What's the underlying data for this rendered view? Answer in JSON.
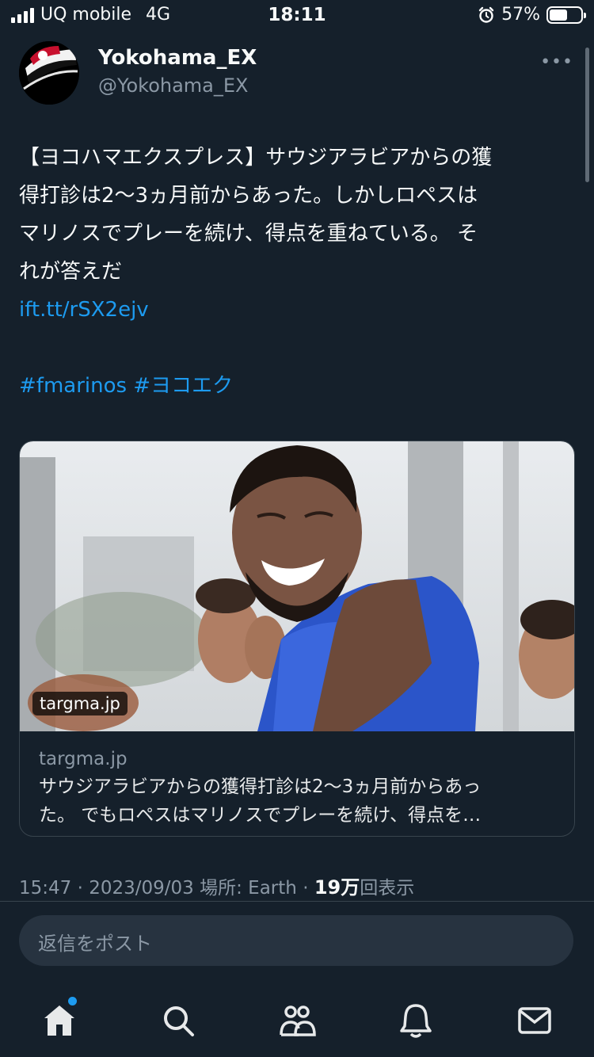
{
  "status_bar": {
    "carrier": "UQ mobile",
    "network": "4G",
    "time": "18:11",
    "battery_percent": "57%",
    "battery_level": 0.57,
    "icons": [
      "signal-icon",
      "alarm-icon",
      "battery-icon"
    ]
  },
  "tweet": {
    "display_name": "Yokohama_EX",
    "handle": "@Yokohama_EX",
    "more_label": "•••",
    "text_lines": [
      "【ヨコハマエクスプレス】サウジアラビアからの獲",
      "得打診は2〜3ヵ月前からあった。しかしロペスは",
      "マリノスでプレーを続け、得点を重ねている。 そ",
      "れが答えだ"
    ],
    "link": "ift.tt/rSX2ejv",
    "hashtags": "#fmarinos #ヨコエク",
    "card": {
      "domain_badge": "targma.jp",
      "domain": "targma.jp",
      "title_line1": "サウジアラビアからの獲得打診は2〜3ヵ月前からあっ",
      "title_line2": "た。 でもロペスはマリノスでプレーを続け、得点を…"
    },
    "meta": {
      "time": "15:47",
      "separator": "·",
      "date": "2023/09/03",
      "location": "場所: Earth",
      "views_count": "19万",
      "views_label": "回表示"
    }
  },
  "reply": {
    "placeholder": "返信をポスト"
  },
  "tabbar": {
    "items": [
      "home-icon",
      "search-icon",
      "communities-icon",
      "notifications-icon",
      "messages-icon"
    ]
  },
  "colors": {
    "background": "#15202b",
    "accent": "#1d9bf0",
    "secondary_text": "#8b98a5",
    "border": "#38444d"
  }
}
